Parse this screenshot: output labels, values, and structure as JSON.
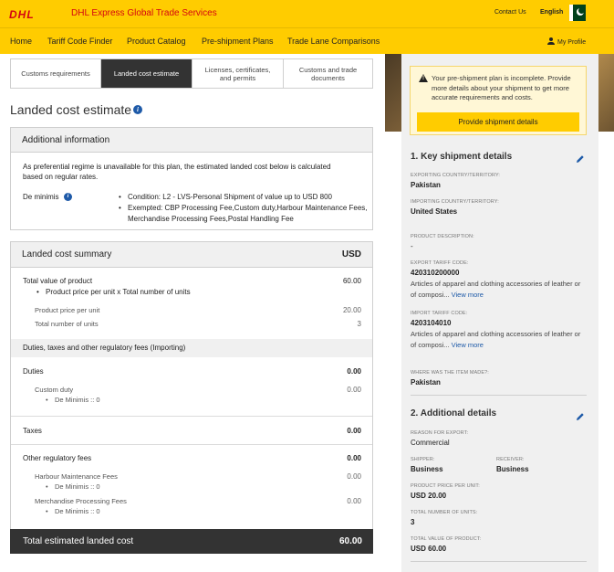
{
  "header": {
    "logo": "DHL",
    "title": "DHL Express Global Trade Services",
    "contact": "Contact Us",
    "language": "English"
  },
  "nav": {
    "items": [
      "Home",
      "Tariff Code Finder",
      "Product Catalog",
      "Pre-shipment Plans",
      "Trade Lane Comparisons"
    ],
    "profile": "My Profile"
  },
  "tabs": [
    {
      "label": "Customs requirements",
      "active": false
    },
    {
      "label": "Landed cost estimate",
      "active": true
    },
    {
      "label": "Licenses, certificates, and permits",
      "active": false
    },
    {
      "label": "Customs and trade documents",
      "active": false
    }
  ],
  "page_title": "Landed cost estimate",
  "additional_info": {
    "title": "Additional information",
    "note_line1": "As preferential regime is unavailable for this plan, the estimated landed cost below is calculated",
    "note_line2": "based on regular rates.",
    "de_minimis_label": "De minimis",
    "condition": "Condition: L2 - LVS-Personal Shipment of value up to USD 800",
    "exempted_line1": "Exempted: CBP Processing Fee,Custom duty,Harbour Maintenance Fees,",
    "exempted_line2": "Merchandise Processing Fees,Postal Handling Fee"
  },
  "summary": {
    "title": "Landed cost summary",
    "currency": "USD",
    "total_value_label": "Total value of product",
    "total_value": "60.00",
    "formula": "Product price per unit x Total number of units",
    "price_per_unit_label": "Product price per unit",
    "price_per_unit": "20.00",
    "units_label": "Total number of units",
    "units": "3",
    "duties_section": "Duties, taxes and other regulatory fees (Importing)",
    "duties_label": "Duties",
    "duties_value": "0.00",
    "custom_duty_label": "Custom duty",
    "custom_duty_value": "0.00",
    "custom_duty_deminimis": "De Minimis :: 0",
    "taxes_label": "Taxes",
    "taxes_value": "0.00",
    "other_fees_label": "Other regulatory fees",
    "other_fees_value": "0.00",
    "harbour_label": "Harbour Maintenance Fees",
    "harbour_value": "0.00",
    "harbour_deminimis": "De Minimis :: 0",
    "merch_label": "Merchandise Processing Fees",
    "merch_value": "0.00",
    "merch_deminimis": "De Minimis :: 0",
    "total_label": "Total estimated landed cost",
    "total_value_final": "60.00"
  },
  "alert": {
    "text": "Your pre-shipment plan is incomplete. Provide more details about your shipment to get more accurate requirements and costs.",
    "button": "Provide shipment details"
  },
  "key_details": {
    "title": "1. Key shipment details",
    "export_country_label": "EXPORTING COUNTRY/TERRITORY:",
    "export_country": "Pakistan",
    "import_country_label": "IMPORTING COUNTRY/TERRITORY:",
    "import_country": "United States",
    "product_desc_label": "PRODUCT DESCRIPTION:",
    "product_desc": "-",
    "export_code_label": "EXPORT TARIFF CODE:",
    "export_code": "420310200000",
    "export_desc_line1": "Articles of apparel and clothing accessories of leather or",
    "export_desc_line2": "of composi...",
    "view_more": "View more",
    "import_code_label": "IMPORT TARIFF CODE:",
    "import_code": "4203104010",
    "import_desc_line1": "Articles of apparel and clothing accessories of leather or",
    "import_desc_line2": "of composi...",
    "made_label": "WHERE WAS THE ITEM MADE?:",
    "made": "Pakistan"
  },
  "additional_details": {
    "title": "2. Additional details",
    "reason_label": "REASON FOR EXPORT:",
    "reason": "Commercial",
    "shipper_label": "SHIPPER:",
    "shipper": "Business",
    "receiver_label": "RECEIVER:",
    "receiver": "Business",
    "price_label": "PRODUCT PRICE PER UNIT:",
    "price": "USD 20.00",
    "units_label": "TOTAL NUMBER OF UNITS:",
    "units": "3",
    "total_label": "TOTAL VALUE OF PRODUCT:",
    "total": "USD 60.00"
  }
}
